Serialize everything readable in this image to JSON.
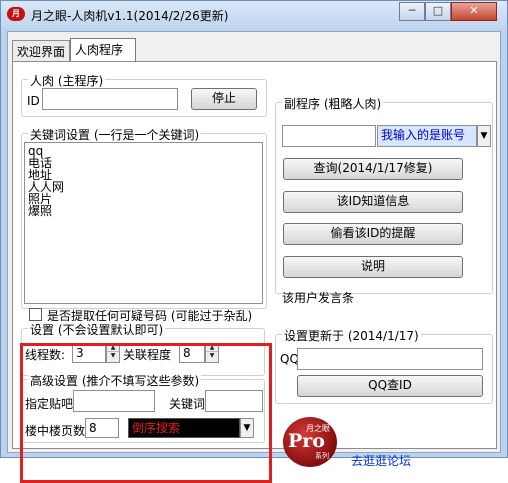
{
  "window": {
    "title": "月之眼-人肉机v1.1(2014/2/26更新)",
    "icon_text": "月",
    "controls": [
      "─",
      "□",
      "✕"
    ]
  },
  "tabs": [
    {
      "label": "欢迎界面"
    },
    {
      "label": "人肉程序"
    }
  ],
  "main_program": {
    "legend": "人肉 (主程序)",
    "id_label": "ID",
    "id_value": "",
    "stop_button": "停止"
  },
  "keywords": {
    "legend": "关键词设置 (一行是一个关键词)",
    "lines": [
      "qq",
      "电话",
      "地址",
      "人人网",
      "照片",
      "爆照"
    ]
  },
  "extract_checkbox": {
    "label": "是否提取任何可疑号码 (可能过于杂乱)",
    "checked": false
  },
  "settings": {
    "legend": "设置 (不会设置默认即可)",
    "threads_label": "线程数:",
    "threads_value": "3",
    "relation_label": "关联程度",
    "relation_value": "8"
  },
  "advanced": {
    "legend": "高级设置 (推介不填写这些参数)",
    "forum_label": "指定贴吧",
    "forum_value": "",
    "keyword_label": "关键词",
    "keyword_value": "",
    "pages_label": "楼中楼页数",
    "pages_value": "8",
    "sort_value": "倒序搜索",
    "sort_color": "#e02020"
  },
  "secondary": {
    "legend": "副程序 (粗略人肉)",
    "input_value": "",
    "select_value": "我输入的是账号",
    "buttons": [
      "查询(2014/1/17修复)",
      "该ID知道信息",
      "偷看该ID的提醒",
      "说明"
    ],
    "status_text": "该用户发言条"
  },
  "update": {
    "legend": "设置更新于 (2014/1/17)",
    "qq_label": "QQ",
    "qq_value": "",
    "qq_button": "QQ查ID"
  },
  "logo": {
    "text_big": "Pro",
    "text_small_1": "月之眼",
    "text_small_2": "系列"
  },
  "forum_link": "去逛逛论坛",
  "colors": {
    "highlight_border": "#e02020",
    "link": "#0033cc",
    "select_text": "#0000cc"
  }
}
